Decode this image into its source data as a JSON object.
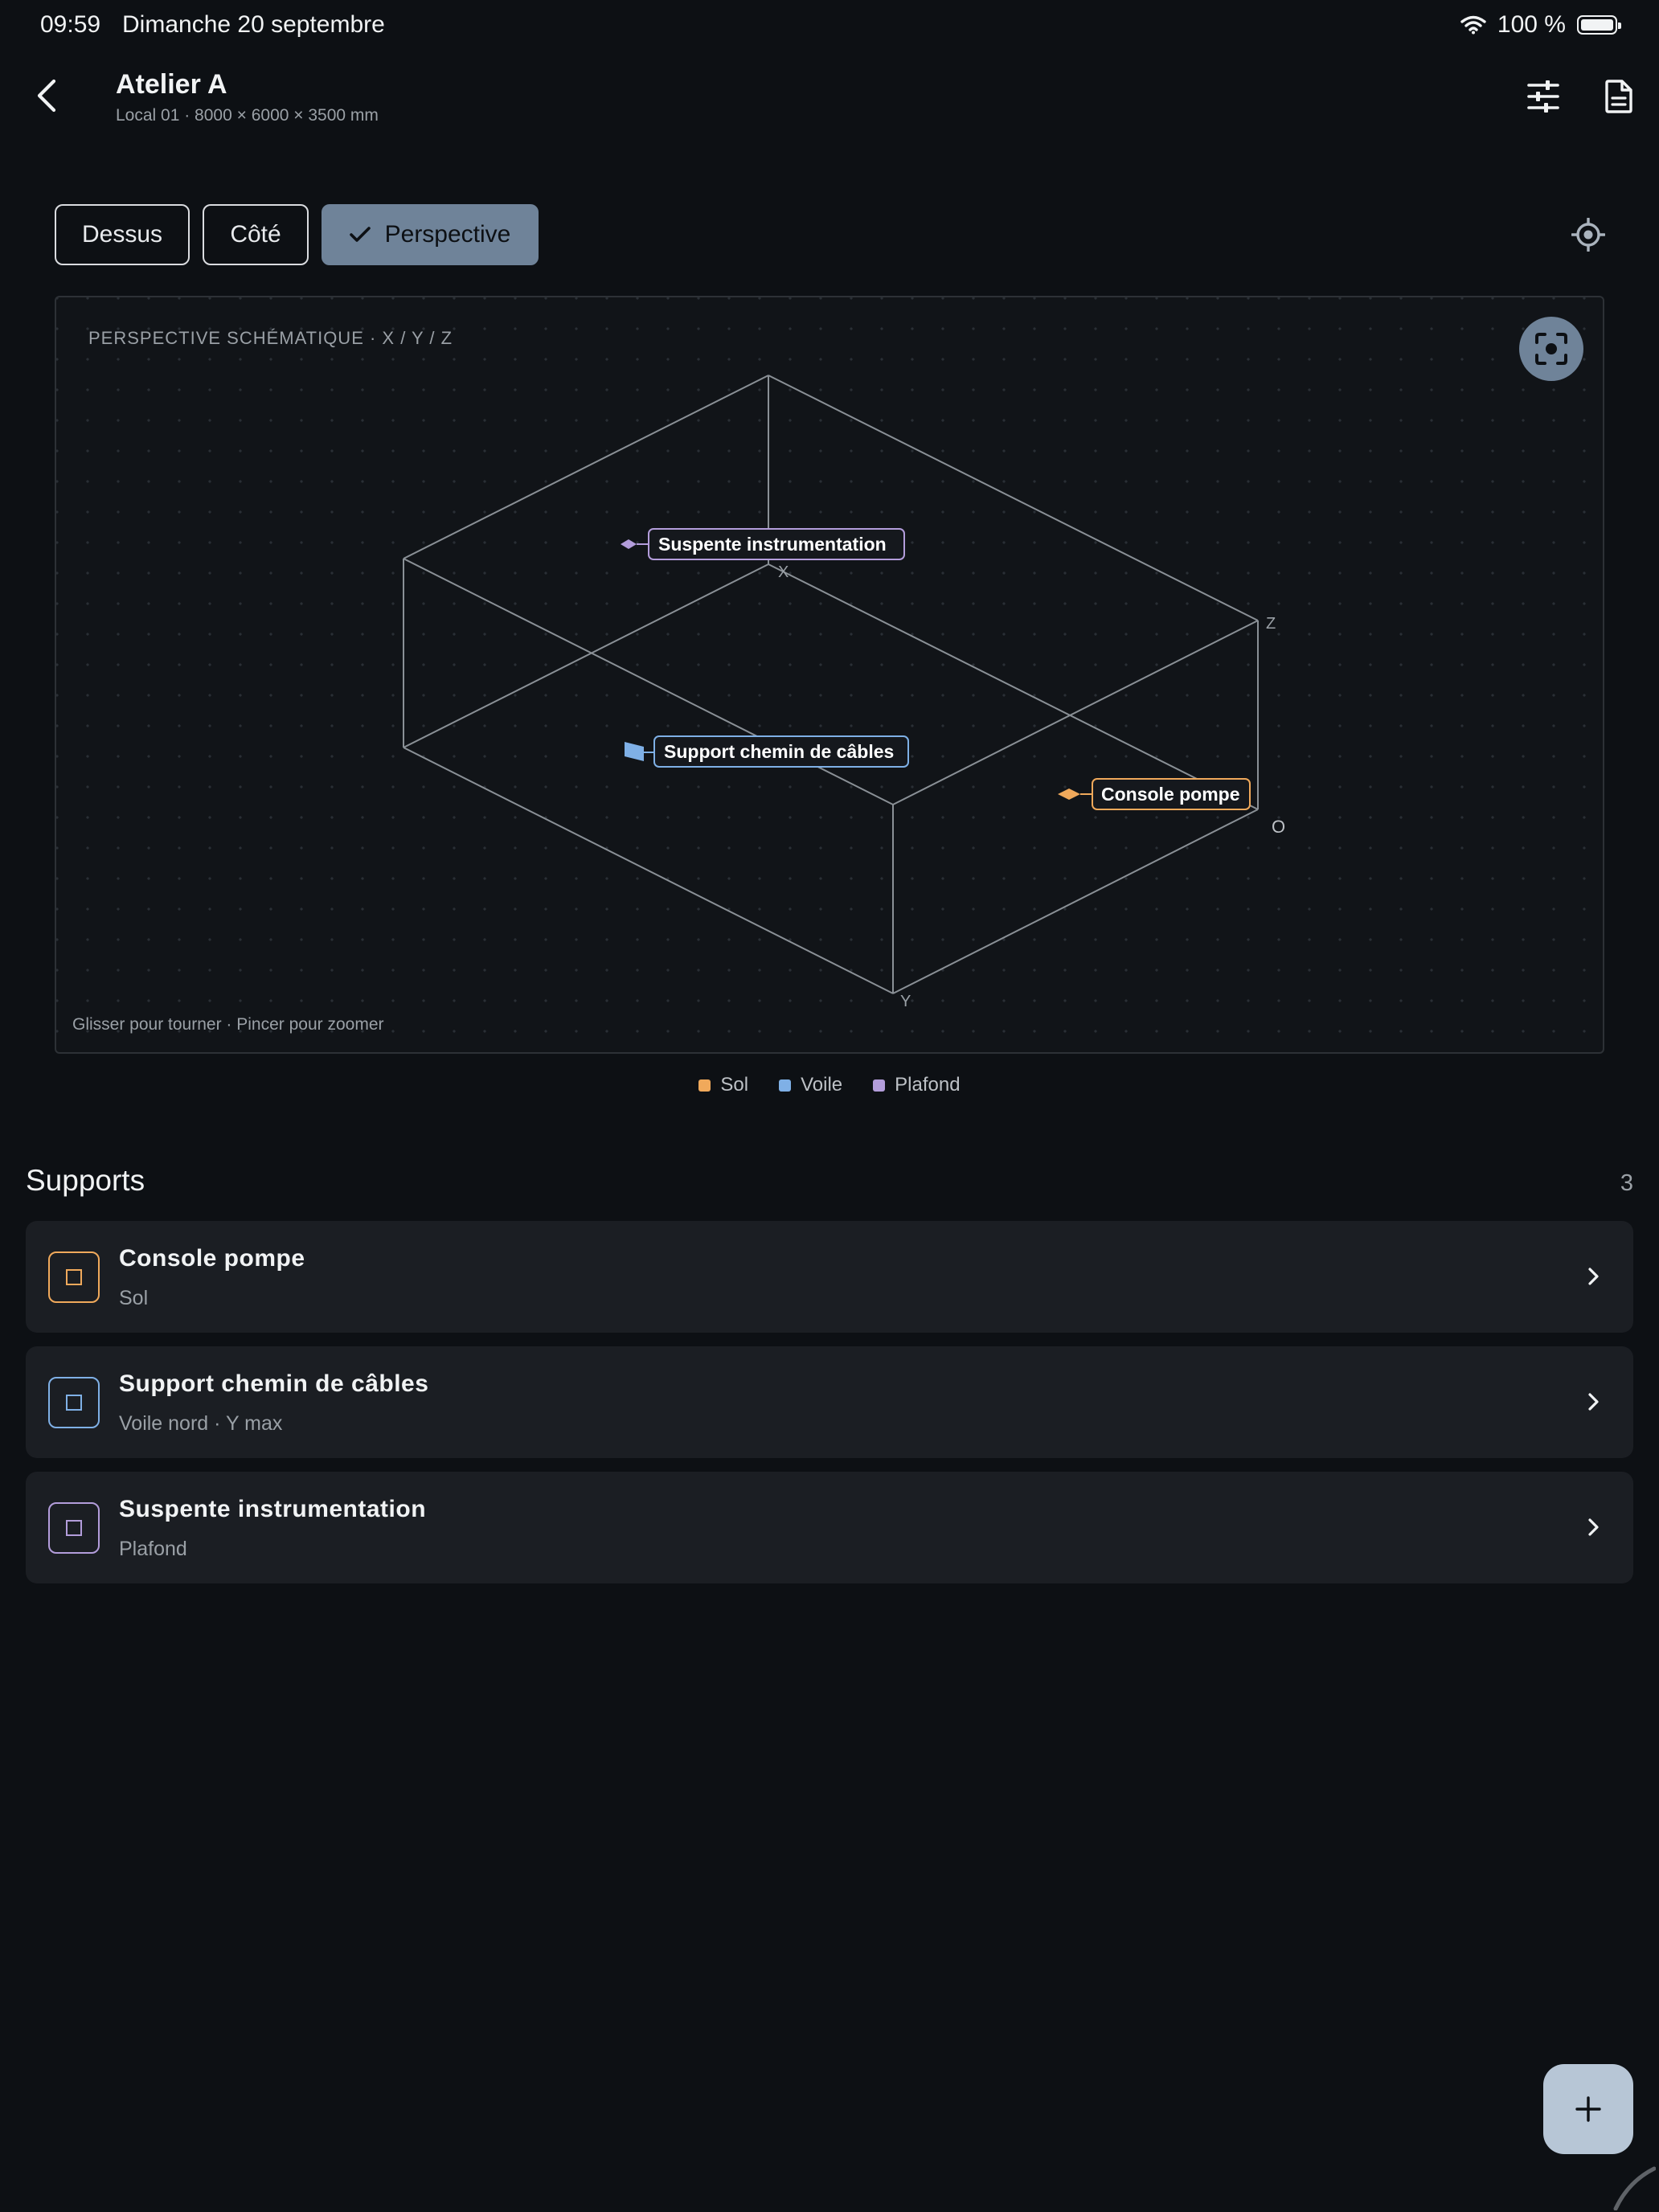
{
  "status_bar": {
    "time": "09:59",
    "date": "Dimanche 20 septembre",
    "battery": "100 %"
  },
  "header": {
    "title": "Atelier A",
    "subtitle": "Local 01 · 8000 × 6000 × 3500 mm"
  },
  "view_tabs": [
    {
      "label": "Dessus",
      "active": false
    },
    {
      "label": "Côté",
      "active": false
    },
    {
      "label": "Perspective",
      "active": true
    }
  ],
  "viewer": {
    "title": "PERSPECTIVE SCHÉMATIQUE · X / Y / Z",
    "hint": "Glisser pour tourner · Pincer pour zoomer",
    "axis_labels": {
      "x": "X",
      "y": "Y",
      "z": "Z",
      "origin": "O"
    },
    "tags": [
      {
        "label": "Suspente instrumentation",
        "color": "#b39ddb"
      },
      {
        "label": "Support chemin de câbles",
        "color": "#7fb0e6"
      },
      {
        "label": "Console pompe",
        "color": "#f0a95b"
      }
    ]
  },
  "legend": [
    {
      "label": "Sol",
      "color": "#f0a95b"
    },
    {
      "label": "Voile",
      "color": "#7fb0e6"
    },
    {
      "label": "Plafond",
      "color": "#b39ddb"
    }
  ],
  "supports": {
    "title": "Supports",
    "count": "3",
    "items": [
      {
        "name": "Console pompe",
        "sub": "Sol",
        "color": "#f0a95b"
      },
      {
        "name": "Support chemin de câbles",
        "sub": "Voile nord · Y max",
        "color": "#7fb0e6"
      },
      {
        "name": "Suspente instrumentation",
        "sub": "Plafond",
        "color": "#b39ddb"
      }
    ]
  },
  "icons": {
    "back": "chevron-left-icon",
    "filters": "sliders-icon",
    "report": "document-icon",
    "locate": "crosshair-icon",
    "recenter": "focus-frame-icon",
    "add": "plus-icon"
  }
}
